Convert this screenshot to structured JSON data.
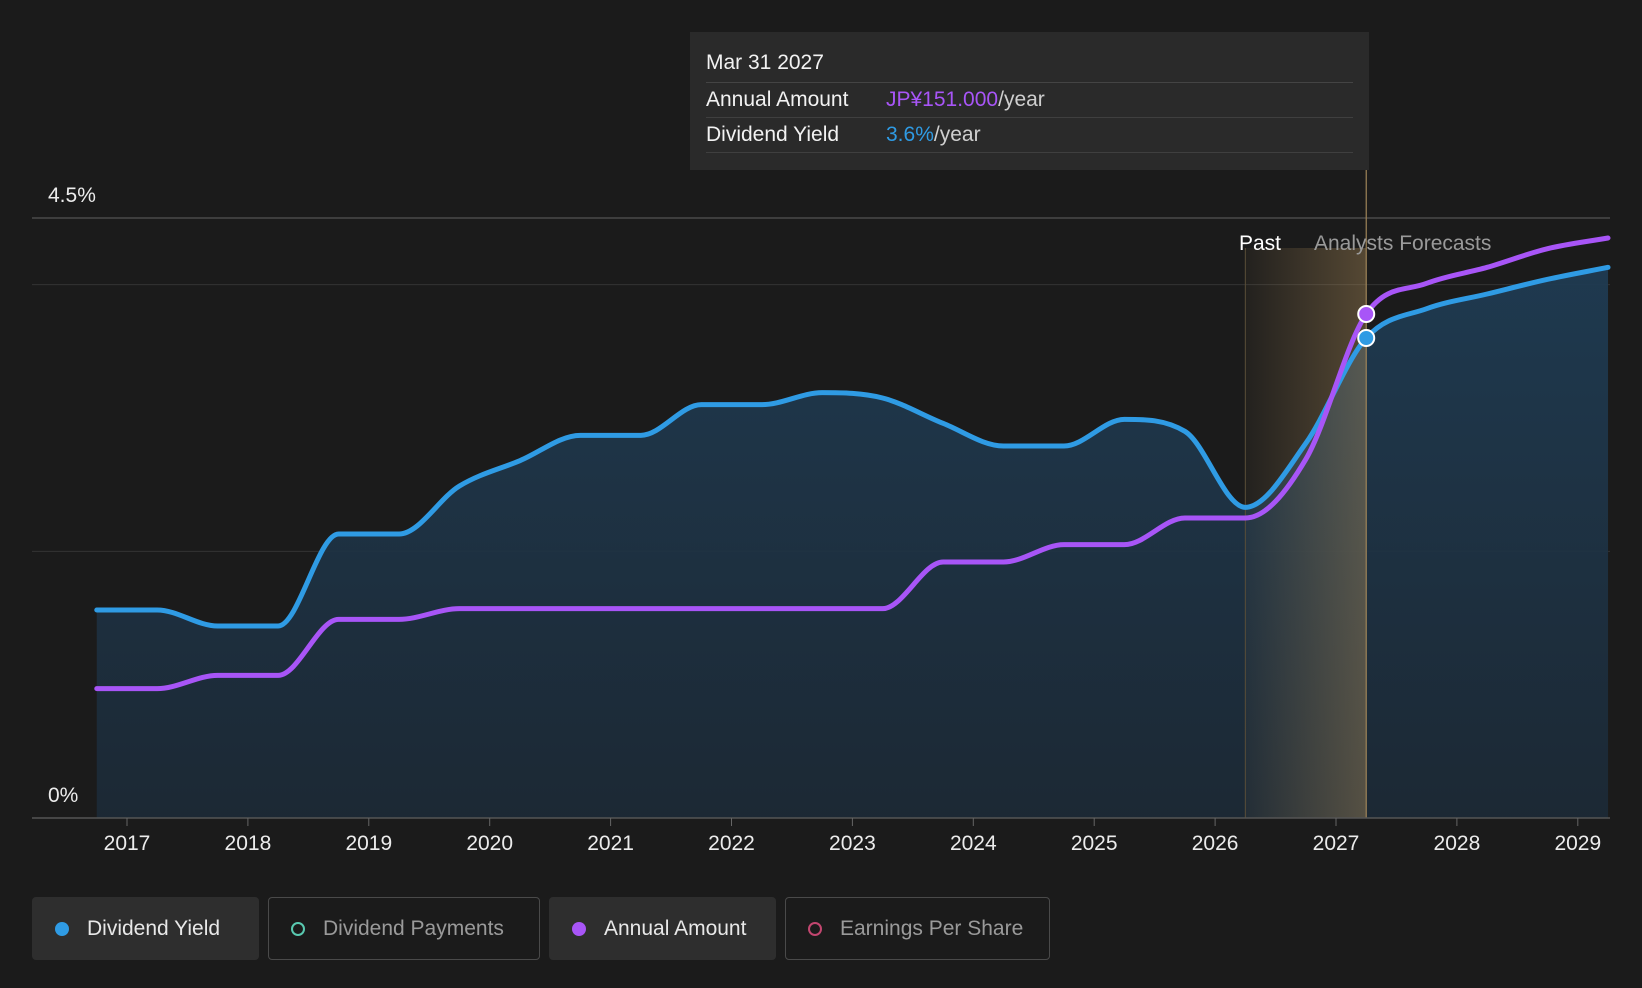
{
  "tooltip": {
    "date": "Mar 31 2027",
    "rows": [
      {
        "label": "Annual Amount",
        "value": "JP¥151.000",
        "unit": "/year",
        "color": "#a855f7"
      },
      {
        "label": "Dividend Yield",
        "value": "3.6%",
        "unit": "/year",
        "color": "#2f9be4"
      }
    ]
  },
  "regions": {
    "past_label": "Past",
    "forecast_label": "Analysts Forecasts"
  },
  "legend": [
    {
      "label": "Dividend Yield",
      "color": "#2f9be4",
      "active": true,
      "marker": "filled"
    },
    {
      "label": "Dividend Payments",
      "color": "#59c9b0",
      "active": false,
      "marker": "hollow"
    },
    {
      "label": "Annual Amount",
      "color": "#a855f7",
      "active": true,
      "marker": "filled"
    },
    {
      "label": "Earnings Per Share",
      "color": "#c2466f",
      "active": false,
      "marker": "hollow"
    }
  ],
  "chart_data": {
    "type": "line",
    "y_labels": [
      "4.5%",
      "0%"
    ],
    "ylim": [
      0,
      4.5
    ],
    "xlim": [
      2016.5,
      2029.2
    ],
    "x_ticks": [
      2017,
      2018,
      2019,
      2020,
      2021,
      2022,
      2023,
      2024,
      2025,
      2026,
      2027,
      2028,
      2029
    ],
    "past_end": 2026.25,
    "highlight_x": 2027.25,
    "grid": true,
    "colors": {
      "dividend_yield": "#2f9be4",
      "annual_amount": "#a855f7",
      "area_fill": "#1f3347"
    },
    "series": [
      {
        "name": "Dividend Yield",
        "color": "#2f9be4",
        "highlight_y": 3.6,
        "points": [
          [
            2016.75,
            1.56
          ],
          [
            2017.25,
            1.56
          ],
          [
            2017.75,
            1.44
          ],
          [
            2018.25,
            1.44
          ],
          [
            2018.75,
            2.13
          ],
          [
            2019.25,
            2.13
          ],
          [
            2019.75,
            2.49
          ],
          [
            2020.25,
            2.68
          ],
          [
            2020.75,
            2.87
          ],
          [
            2021.25,
            2.87
          ],
          [
            2021.75,
            3.1
          ],
          [
            2022.25,
            3.1
          ],
          [
            2022.75,
            3.19
          ],
          [
            2023.25,
            3.15
          ],
          [
            2023.75,
            2.96
          ],
          [
            2024.25,
            2.79
          ],
          [
            2024.75,
            2.79
          ],
          [
            2025.25,
            2.99
          ],
          [
            2025.75,
            2.9
          ],
          [
            2026.25,
            2.33
          ],
          [
            2026.75,
            2.81
          ],
          [
            2027.25,
            3.6
          ],
          [
            2027.75,
            3.82
          ],
          [
            2028.25,
            3.93
          ],
          [
            2028.75,
            4.04
          ],
          [
            2029.25,
            4.13
          ]
        ]
      },
      {
        "name": "Annual Amount",
        "color": "#a855f7",
        "highlight_y": 3.78,
        "points": [
          [
            2016.75,
            0.97
          ],
          [
            2017.25,
            0.97
          ],
          [
            2017.75,
            1.07
          ],
          [
            2018.25,
            1.07
          ],
          [
            2018.75,
            1.49
          ],
          [
            2019.25,
            1.49
          ],
          [
            2019.75,
            1.57
          ],
          [
            2020.25,
            1.57
          ],
          [
            2020.75,
            1.57
          ],
          [
            2021.25,
            1.57
          ],
          [
            2021.75,
            1.57
          ],
          [
            2022.25,
            1.57
          ],
          [
            2022.75,
            1.57
          ],
          [
            2023.25,
            1.57
          ],
          [
            2023.75,
            1.92
          ],
          [
            2024.25,
            1.92
          ],
          [
            2024.75,
            2.05
          ],
          [
            2025.25,
            2.05
          ],
          [
            2025.75,
            2.25
          ],
          [
            2026.25,
            2.25
          ],
          [
            2026.75,
            2.69
          ],
          [
            2027.25,
            3.78
          ],
          [
            2027.75,
            4.01
          ],
          [
            2028.25,
            4.13
          ],
          [
            2028.75,
            4.27
          ],
          [
            2029.25,
            4.35
          ]
        ]
      }
    ]
  }
}
